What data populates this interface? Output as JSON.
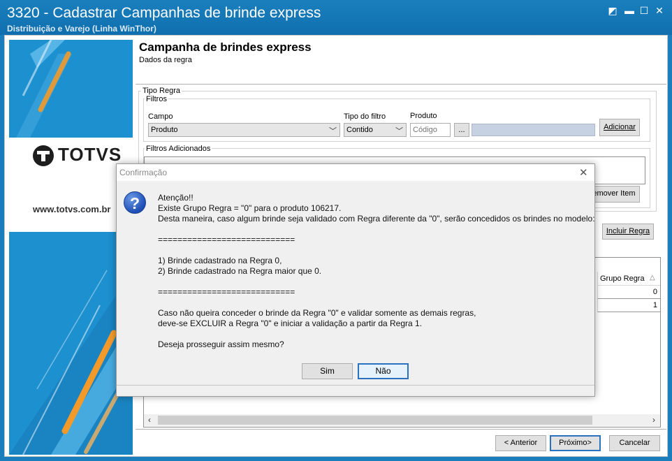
{
  "window": {
    "title": "3320 - Cadastrar Campanhas de brinde express",
    "subtitle": "Distribuição e Varejo (Linha WinThor)"
  },
  "banner": {
    "brand": "TOTVS",
    "website": "www.totvs.com.br"
  },
  "header": {
    "title": "Campanha de brindes express",
    "subtitle": "Dados da regra"
  },
  "tipo_regra": {
    "label": "Tipo Regra",
    "filtros": {
      "label": "Filtros",
      "campo_label": "Campo",
      "campo_value": "Produto",
      "tipo_filtro_label": "Tipo do filtro",
      "tipo_filtro_value": "Contido",
      "produto_label": "Produto",
      "produto_placeholder": "Código",
      "ellipsis": "...",
      "add_button": "Adicionar"
    },
    "filtros_adicionados": {
      "label": "Filtros Adicionados",
      "remove_button": "Remover Item"
    }
  },
  "incluir_regra_button": "Incluir Regra",
  "grid": {
    "column_header": "Grupo Regra",
    "sort_glyph": "△",
    "rows": [
      "0",
      "1"
    ]
  },
  "footer": {
    "back": "< Anterior",
    "next": "Próximo>",
    "cancel": "Cancelar"
  },
  "dialog": {
    "title": "Confirmação",
    "lines": [
      "Atenção!!",
      "Existe Grupo Regra = \"0\" para o produto 106217.",
      "Desta maneira, caso algum brinde seja validado com Regra diferente da \"0\", serão concedidos os brindes no modelo:",
      "============================",
      "1) Brinde cadastrado na Regra 0,",
      "2) Brinde cadastrado na Regra maior que 0.",
      "============================",
      "Caso não queira conceder o brinde da Regra \"0\" e validar somente as demais regras,",
      "deve-se EXCLUIR a Regra \"0\" e iniciar a validação a partir da Regra 1.",
      "Deseja prosseguir assim mesmo?"
    ],
    "yes": "Sim",
    "no": "Não"
  },
  "colors": {
    "title_bar": "#1b7fbd",
    "banner": "#1d90cf",
    "accent_orange": "#f39a2b",
    "default_button_border": "#2a72c0"
  }
}
